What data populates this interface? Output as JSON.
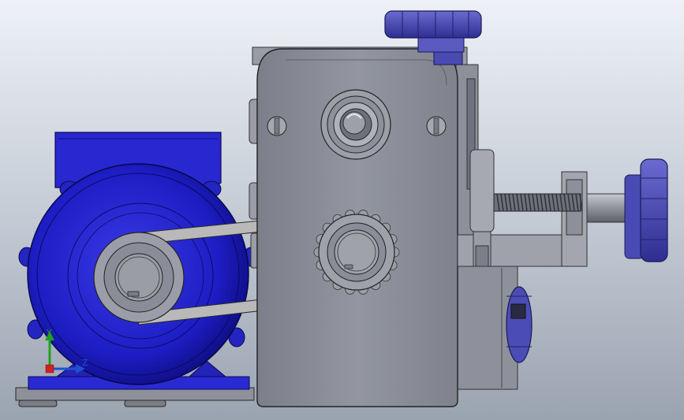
{
  "viewport": {
    "background_top": "#eef2f7",
    "background_bottom": "#9aa3b0"
  },
  "model": {
    "motor_color": "#2020c8",
    "knob_color": "#4848b8",
    "housing_color": "#8a8d98",
    "base_color": "#9a9ca6",
    "belt_color": "#b8b8b8"
  },
  "triad": {
    "y_label": "Y",
    "z_label": "Z",
    "y_color": "#20a020",
    "z_color": "#2050d0"
  }
}
